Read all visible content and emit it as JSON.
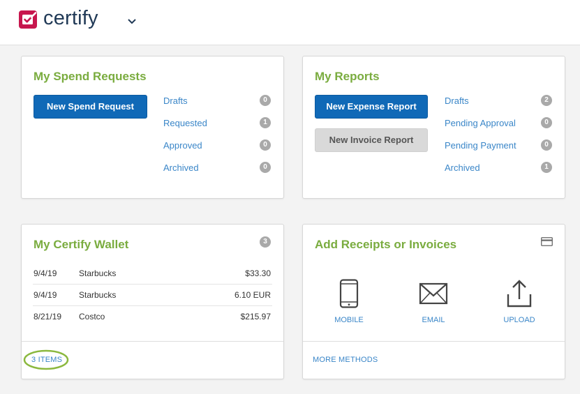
{
  "header": {
    "logo_text": "certify",
    "icons": [
      "check-icon",
      "chevron-down-icon"
    ],
    "brand_color": "#c7174e"
  },
  "spend": {
    "title": "My Spend Requests",
    "new_button": "New Spend Request",
    "items": [
      {
        "label": "Drafts",
        "count": "0"
      },
      {
        "label": "Requested",
        "count": "1"
      },
      {
        "label": "Approved",
        "count": "0"
      },
      {
        "label": "Archived",
        "count": "0"
      }
    ]
  },
  "reports": {
    "title": "My Reports",
    "new_expense_button": "New Expense Report",
    "new_invoice_button": "New Invoice Report",
    "items": [
      {
        "label": "Drafts",
        "count": "2"
      },
      {
        "label": "Pending Approval",
        "count": "0"
      },
      {
        "label": "Pending Payment",
        "count": "0"
      },
      {
        "label": "Archived",
        "count": "1"
      }
    ]
  },
  "wallet": {
    "title": "My Certify Wallet",
    "count": "3",
    "rows": [
      {
        "date": "9/4/19",
        "merchant": "Starbucks",
        "amount": "$33.30"
      },
      {
        "date": "9/4/19",
        "merchant": "Starbucks",
        "amount": "6.10 EUR"
      },
      {
        "date": "8/21/19",
        "merchant": "Costco",
        "amount": "$215.97"
      }
    ],
    "footer_link": "3 ITEMS",
    "highlight_color": "#8bb83e"
  },
  "receipts": {
    "title": "Add Receipts or Invoices",
    "methods": [
      {
        "label": "MOBILE",
        "icon": "mobile-phone-icon"
      },
      {
        "label": "EMAIL",
        "icon": "envelope-icon"
      },
      {
        "label": "UPLOAD",
        "icon": "upload-icon"
      }
    ],
    "card_icon": "credit-card-icon",
    "footer_link": "MORE METHODS"
  },
  "colors": {
    "title_green": "#7aac3f",
    "primary_blue": "#1069b7",
    "link_blue": "#3a86c8"
  }
}
